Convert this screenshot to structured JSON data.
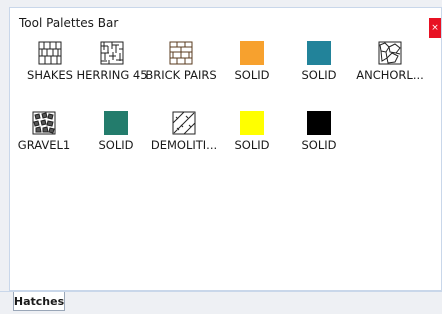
{
  "window": {
    "title": "Tool Palettes Bar",
    "close_label": "×"
  },
  "tools": [
    {
      "label": "SHAKES",
      "icon": "shakes-hatch-icon"
    },
    {
      "label": "HERRING 45",
      "icon": "herring-hatch-icon"
    },
    {
      "label": "BRICK PAIRS",
      "icon": "brick-pairs-hatch-icon"
    },
    {
      "label": "SOLID",
      "icon": "solid-swatch-icon",
      "color": "#f7a12e"
    },
    {
      "label": "SOLID",
      "icon": "solid-swatch-icon",
      "color": "#22839a"
    },
    {
      "label": "ANCHORL...",
      "icon": "anchorlock-hatch-icon"
    },
    {
      "label": "GRAVEL1",
      "icon": "gravel-hatch-icon"
    },
    {
      "label": "SOLID",
      "icon": "solid-swatch-icon",
      "color": "#237c6c"
    },
    {
      "label": "DEMOLITI...",
      "icon": "demolition-hatch-icon"
    },
    {
      "label": "SOLID",
      "icon": "solid-swatch-icon",
      "color": "#ffff00"
    },
    {
      "label": "SOLID",
      "icon": "solid-swatch-icon",
      "color": "#000000"
    }
  ],
  "tabs": [
    {
      "label": "Hatches"
    }
  ]
}
